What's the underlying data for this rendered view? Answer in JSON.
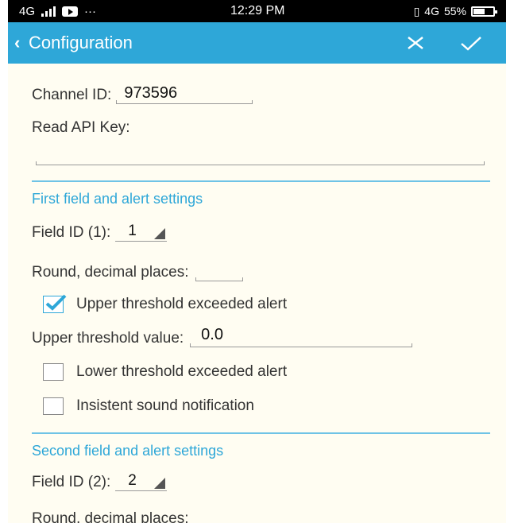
{
  "status_bar": {
    "network": "4G",
    "more": "···",
    "time": "12:29 PM",
    "right_indicators": "4G",
    "battery": "55%"
  },
  "app_bar": {
    "title": "Configuration",
    "back_icon": "chevron-left-icon",
    "close_icon": "close-icon",
    "confirm_icon": "check-icon",
    "color": "#2ea7d8"
  },
  "form": {
    "channel_id_label": "Channel ID:",
    "channel_id_value": "973596",
    "read_api_key_label": "Read API Key:",
    "read_api_key_value": "",
    "first_section": {
      "title": "First field and alert settings",
      "field_id_label": "Field ID (1):",
      "field_id_value": "1",
      "round_label": "Round, decimal places:",
      "round_value": "",
      "upper_alert_label": "Upper threshold exceeded alert",
      "upper_alert_checked": true,
      "upper_value_label": "Upper threshold value:",
      "upper_value": "0.0",
      "lower_alert_label": "Lower threshold exceeded alert",
      "lower_alert_checked": false,
      "insistent_label": "Insistent sound notification",
      "insistent_checked": false
    },
    "second_section": {
      "title": "Second field and alert settings",
      "field_id_label": "Field ID (2):",
      "field_id_value": "2",
      "round_label": "Round, decimal places:"
    }
  }
}
